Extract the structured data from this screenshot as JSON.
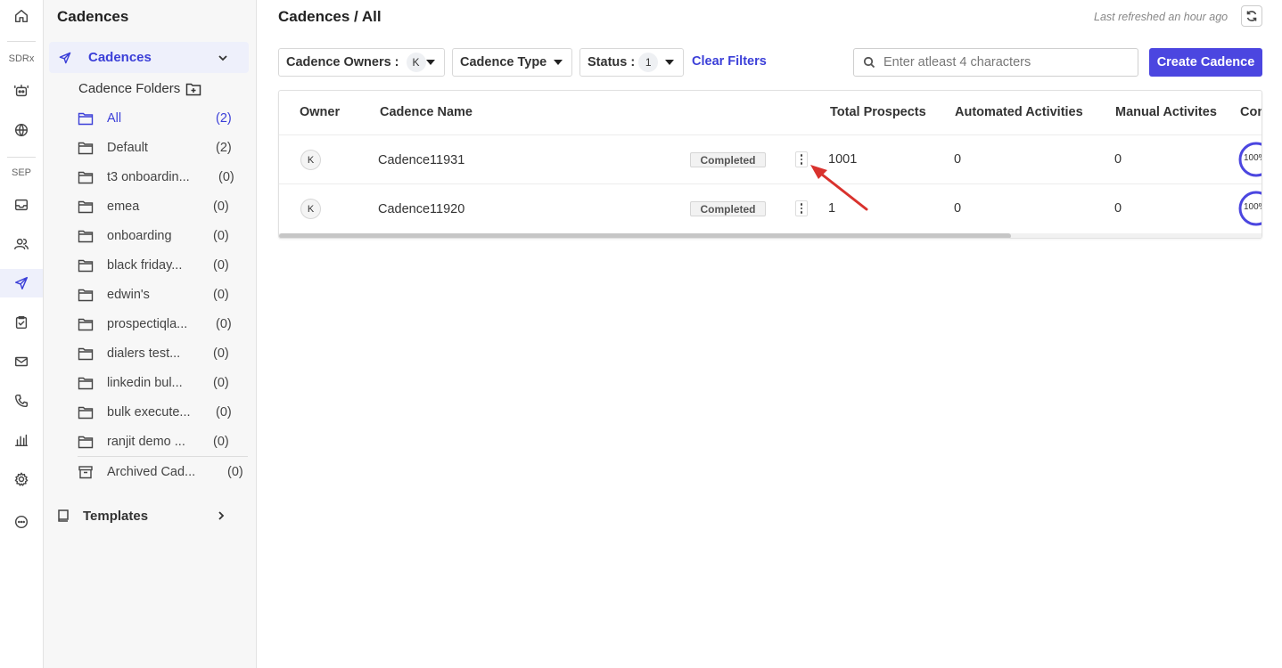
{
  "rail": {
    "section_sdrx": "SDRx",
    "section_sep": "SEP"
  },
  "sidebar": {
    "title": "Cadences",
    "cadences_label": "Cadences",
    "folders_title": "Cadence Folders",
    "folders": [
      {
        "name": "All",
        "count": "(2)"
      },
      {
        "name": "Default",
        "count": "(2)"
      },
      {
        "name": "t3 onboardin...",
        "count": "(0)"
      },
      {
        "name": "emea",
        "count": "(0)"
      },
      {
        "name": "onboarding",
        "count": "(0)"
      },
      {
        "name": "black friday...",
        "count": "(0)"
      },
      {
        "name": "edwin's",
        "count": "(0)"
      },
      {
        "name": "prospectiqla...",
        "count": "(0)"
      },
      {
        "name": "dialers test...",
        "count": "(0)"
      },
      {
        "name": "linkedin bul...",
        "count": "(0)"
      },
      {
        "name": "bulk execute...",
        "count": "(0)"
      },
      {
        "name": "ranjit demo ...",
        "count": "(0)"
      }
    ],
    "archived": {
      "name": "Archived Cad...",
      "count": "(0)"
    },
    "templates_label": "Templates"
  },
  "header": {
    "title": "Cadences / All",
    "refreshed": "Last refreshed an hour ago"
  },
  "filters": {
    "owners_label": "Cadence Owners :",
    "owners_badge": "K",
    "type_label": "Cadence Type",
    "status_label": "Status :",
    "status_badge": "1",
    "clear_label": "Clear Filters",
    "search_placeholder": "Enter atleast 4 characters",
    "create_label": "Create Cadence"
  },
  "table": {
    "columns": [
      "Owner",
      "Cadence Name",
      "Total Prospects",
      "Automated Activities",
      "Manual Activites",
      "Con"
    ],
    "rows": [
      {
        "owner": "K",
        "name": "Cadence11931",
        "status": "Completed",
        "total": "1001",
        "automated": "0",
        "manual": "0",
        "completion": "100%",
        "completion_value": 100
      },
      {
        "owner": "K",
        "name": "Cadence11920",
        "status": "Completed",
        "total": "1",
        "automated": "0",
        "manual": "0",
        "completion": "100%",
        "completion_value": 100
      }
    ]
  },
  "colors": {
    "accent": "#3b3fd8",
    "primary_button": "#4b46e0",
    "annotation_arrow": "#d9322d"
  }
}
